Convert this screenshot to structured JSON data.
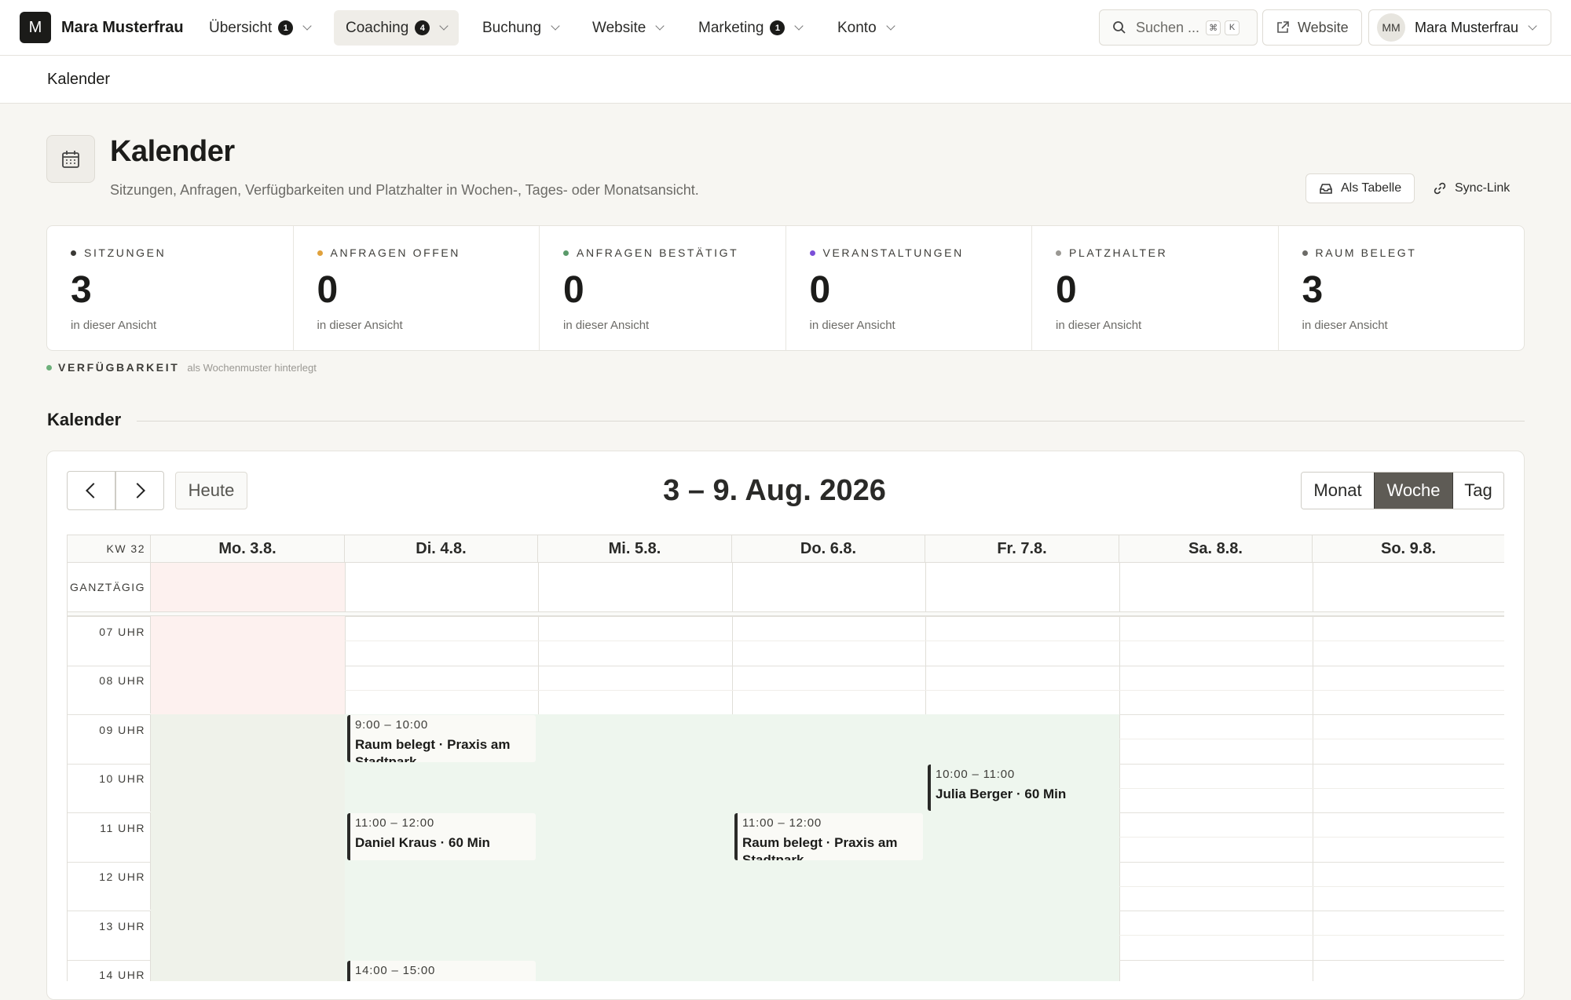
{
  "app": {
    "logo_letter": "M",
    "brand": "Mara Musterfrau"
  },
  "nav": [
    {
      "label": "Übersicht",
      "badge": "1"
    },
    {
      "label": "Coaching",
      "badge": "4"
    },
    {
      "label": "Buchung",
      "badge": ""
    },
    {
      "label": "Website",
      "badge": ""
    },
    {
      "label": "Marketing",
      "badge": "1"
    },
    {
      "label": "Konto",
      "badge": ""
    }
  ],
  "search": {
    "placeholder": "Suchen ...",
    "shortcut": [
      "⌘",
      "K"
    ]
  },
  "topbar": {
    "website_label": "Website",
    "user_initials": "MM",
    "user_name": "Mara Musterfrau"
  },
  "breadcrumb": "Kalender",
  "page": {
    "title": "Kalender",
    "subtitle": "Sitzungen, Anfragen, Verfügbarkeiten und Platzhalter in Wochen-, Tages- oder Monatsansicht.",
    "table_btn": "Als Tabelle",
    "sync_btn": "Sync-Link"
  },
  "stats": [
    {
      "label": "SITZUNGEN",
      "value": "3",
      "hint": "in dieser Ansicht",
      "color": "#3a3935"
    },
    {
      "label": "ANFRAGEN OFFEN",
      "value": "0",
      "hint": "in dieser Ansicht",
      "color": "#e0a13c"
    },
    {
      "label": "ANFRAGEN BESTÄTIGT",
      "value": "0",
      "hint": "in dieser Ansicht",
      "color": "#5a9a6a"
    },
    {
      "label": "VERANSTALTUNGEN",
      "value": "0",
      "hint": "in dieser Ansicht",
      "color": "#7b4fd8"
    },
    {
      "label": "PLATZHALTER",
      "value": "0",
      "hint": "in dieser Ansicht",
      "color": "#9a9893"
    },
    {
      "label": "RAUM BELEGT",
      "value": "3",
      "hint": "in dieser Ansicht",
      "color": "#6c6b67"
    }
  ],
  "availability": {
    "label": "VERFÜGBARKEIT",
    "note": "als Wochenmuster hinterlegt",
    "color": "#6db07a"
  },
  "section_title": "Kalender",
  "calendar": {
    "today_label": "Heute",
    "range": "3 – 9. Aug. 2026",
    "views": [
      "Monat",
      "Woche",
      "Tag"
    ],
    "active_view": "Woche",
    "week_label": "KW 32",
    "allday_label": "GANZTÄGIG",
    "days": [
      "Mo. 3.8.",
      "Di. 4.8.",
      "Mi. 5.8.",
      "Do. 6.8.",
      "Fr. 7.8.",
      "Sa. 8.8.",
      "So. 9.8."
    ],
    "hours": [
      "07 UHR",
      "08 UHR",
      "09 UHR",
      "10 UHR",
      "11 UHR",
      "12 UHR",
      "13 UHR",
      "14 UHR"
    ],
    "events": [
      {
        "day": 1,
        "start": 9,
        "end": 10,
        "time": "9:00 – 10:00",
        "title": "Raum belegt · Praxis am Stadtpark",
        "tint": false
      },
      {
        "day": 1,
        "start": 11,
        "end": 12,
        "time": "11:00 – 12:00",
        "title": "Daniel Kraus · 60 Min",
        "tint": false
      },
      {
        "day": 1,
        "start": 14,
        "end": 15,
        "time": "14:00 – 15:00",
        "title": "",
        "tint": false
      },
      {
        "day": 3,
        "start": 11,
        "end": 12,
        "time": "11:00 – 12:00",
        "title": "Raum belegt · Praxis am Stadtpark",
        "tint": false
      },
      {
        "day": 4,
        "start": 10,
        "end": 11,
        "time": "10:00 – 11:00",
        "title": "Julia Berger · 60 Min",
        "tint": true
      }
    ]
  }
}
